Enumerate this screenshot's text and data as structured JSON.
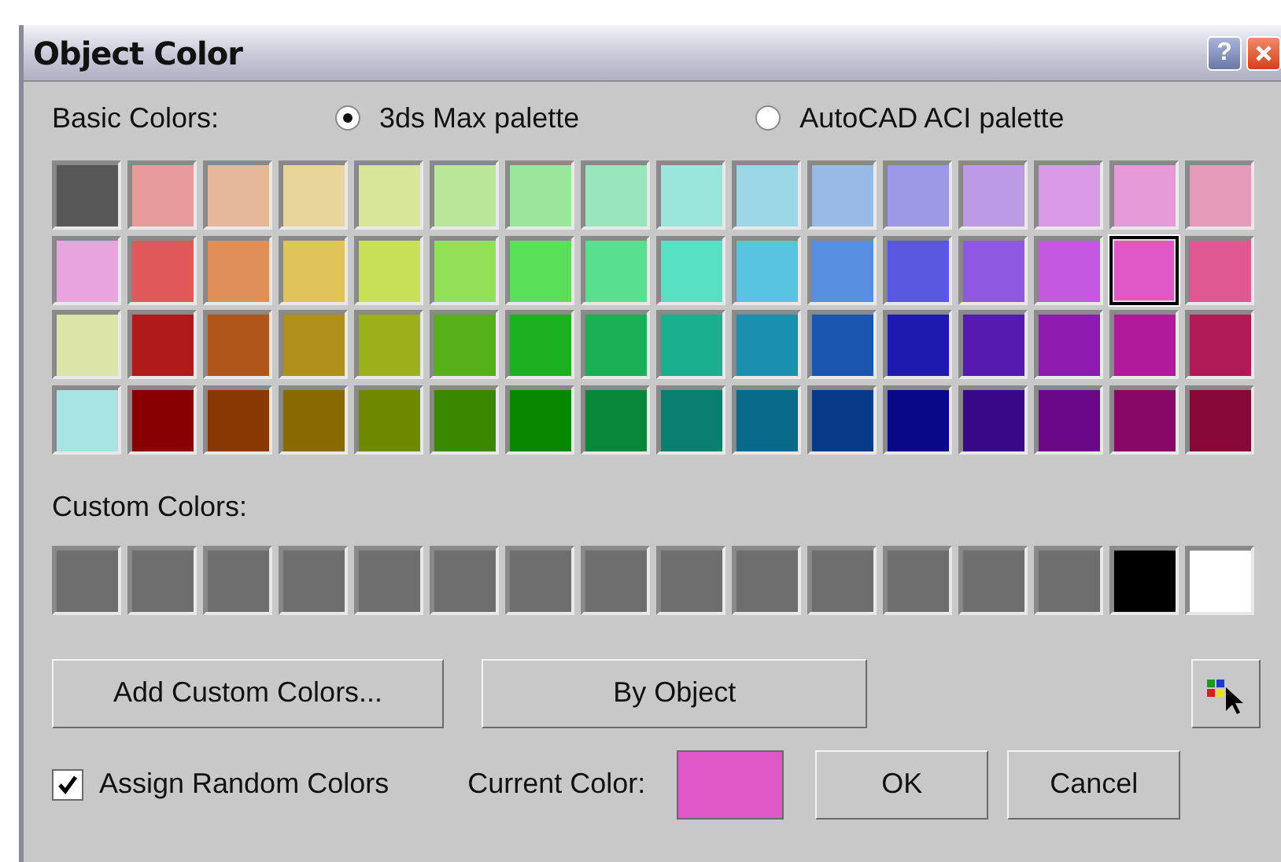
{
  "window": {
    "title": "Object Color"
  },
  "title_buttons": [
    {
      "kind": "help",
      "label": "?"
    },
    {
      "kind": "close"
    }
  ],
  "basic_colors": {
    "label": "Basic Colors:"
  },
  "palettes": [
    {
      "label": "3ds Max palette",
      "selected": true
    },
    {
      "label": "AutoCAD ACI palette",
      "selected": false
    }
  ],
  "swatches": [
    {
      "color": "#585858",
      "selected": false
    },
    {
      "color": "#e69a9a",
      "selected": false
    },
    {
      "color": "#e6b89a",
      "selected": false
    },
    {
      "color": "#e6d69a",
      "selected": false
    },
    {
      "color": "#d8e69a",
      "selected": false
    },
    {
      "color": "#bae69a",
      "selected": false
    },
    {
      "color": "#9ae69c",
      "selected": false
    },
    {
      "color": "#9ae6bc",
      "selected": false
    },
    {
      "color": "#9ae6da",
      "selected": false
    },
    {
      "color": "#9ad8e6",
      "selected": false
    },
    {
      "color": "#9abae6",
      "selected": false
    },
    {
      "color": "#9c9ae6",
      "selected": false
    },
    {
      "color": "#bc9ae6",
      "selected": false
    },
    {
      "color": "#da9ae6",
      "selected": false
    },
    {
      "color": "#e69ad8",
      "selected": false
    },
    {
      "color": "#e69aba",
      "selected": false
    },
    {
      "color": "#e8a4dc",
      "selected": false
    },
    {
      "color": "#e05858",
      "selected": false
    },
    {
      "color": "#e08f58",
      "selected": false
    },
    {
      "color": "#e0c458",
      "selected": false
    },
    {
      "color": "#c8e058",
      "selected": false
    },
    {
      "color": "#92e058",
      "selected": false
    },
    {
      "color": "#5ae058",
      "selected": false
    },
    {
      "color": "#58e08f",
      "selected": false
    },
    {
      "color": "#58e0c4",
      "selected": false
    },
    {
      "color": "#58c4e0",
      "selected": false
    },
    {
      "color": "#588fe0",
      "selected": false
    },
    {
      "color": "#5a58e0",
      "selected": false
    },
    {
      "color": "#8f58e0",
      "selected": false
    },
    {
      "color": "#c458e0",
      "selected": false
    },
    {
      "color": "#e058c8",
      "selected": true
    },
    {
      "color": "#e05892",
      "selected": false
    },
    {
      "color": "#dce4a8",
      "selected": false
    },
    {
      "color": "#b01a1a",
      "selected": false
    },
    {
      "color": "#b0561a",
      "selected": false
    },
    {
      "color": "#b08f1a",
      "selected": false
    },
    {
      "color": "#9bb01a",
      "selected": false
    },
    {
      "color": "#56b01a",
      "selected": false
    },
    {
      "color": "#1ab01e",
      "selected": false
    },
    {
      "color": "#1ab056",
      "selected": false
    },
    {
      "color": "#1ab08f",
      "selected": false
    },
    {
      "color": "#1a8fb0",
      "selected": false
    },
    {
      "color": "#1a56b0",
      "selected": false
    },
    {
      "color": "#1e1ab0",
      "selected": false
    },
    {
      "color": "#561ab0",
      "selected": false
    },
    {
      "color": "#8f1ab0",
      "selected": false
    },
    {
      "color": "#b01a9b",
      "selected": false
    },
    {
      "color": "#b01a56",
      "selected": false
    },
    {
      "color": "#a8e4e4",
      "selected": false
    },
    {
      "color": "#880000",
      "selected": false
    },
    {
      "color": "#883800",
      "selected": false
    },
    {
      "color": "#886a00",
      "selected": false
    },
    {
      "color": "#6e8800",
      "selected": false
    },
    {
      "color": "#3a8800",
      "selected": false
    },
    {
      "color": "#088800",
      "selected": false
    },
    {
      "color": "#088838",
      "selected": false
    },
    {
      "color": "#088070",
      "selected": false
    },
    {
      "color": "#086a88",
      "selected": false
    },
    {
      "color": "#083888",
      "selected": false
    },
    {
      "color": "#080888",
      "selected": false
    },
    {
      "color": "#380888",
      "selected": false
    },
    {
      "color": "#6a0888",
      "selected": false
    },
    {
      "color": "#880868",
      "selected": false
    },
    {
      "color": "#880838",
      "selected": false
    }
  ],
  "custom_colors": {
    "label": "Custom Colors:",
    "swatches": [
      {
        "color": "#6e6e6e"
      },
      {
        "color": "#6e6e6e"
      },
      {
        "color": "#6e6e6e"
      },
      {
        "color": "#6e6e6e"
      },
      {
        "color": "#6e6e6e"
      },
      {
        "color": "#6e6e6e"
      },
      {
        "color": "#6e6e6e"
      },
      {
        "color": "#6e6e6e"
      },
      {
        "color": "#6e6e6e"
      },
      {
        "color": "#6e6e6e"
      },
      {
        "color": "#6e6e6e"
      },
      {
        "color": "#6e6e6e"
      },
      {
        "color": "#6e6e6e"
      },
      {
        "color": "#6e6e6e"
      },
      {
        "color": "#000000"
      },
      {
        "color": "#ffffff"
      }
    ]
  },
  "buttons": [
    {
      "label": "Add Custom Colors..."
    },
    {
      "label": "By Object"
    }
  ],
  "assign_random": {
    "label": "Assign Random Colors",
    "checked": true
  },
  "current_color": {
    "label": "Current Color:",
    "color": "#e058c8"
  },
  "dialog_buttons": [
    {
      "label": "OK"
    },
    {
      "label": "Cancel"
    }
  ]
}
